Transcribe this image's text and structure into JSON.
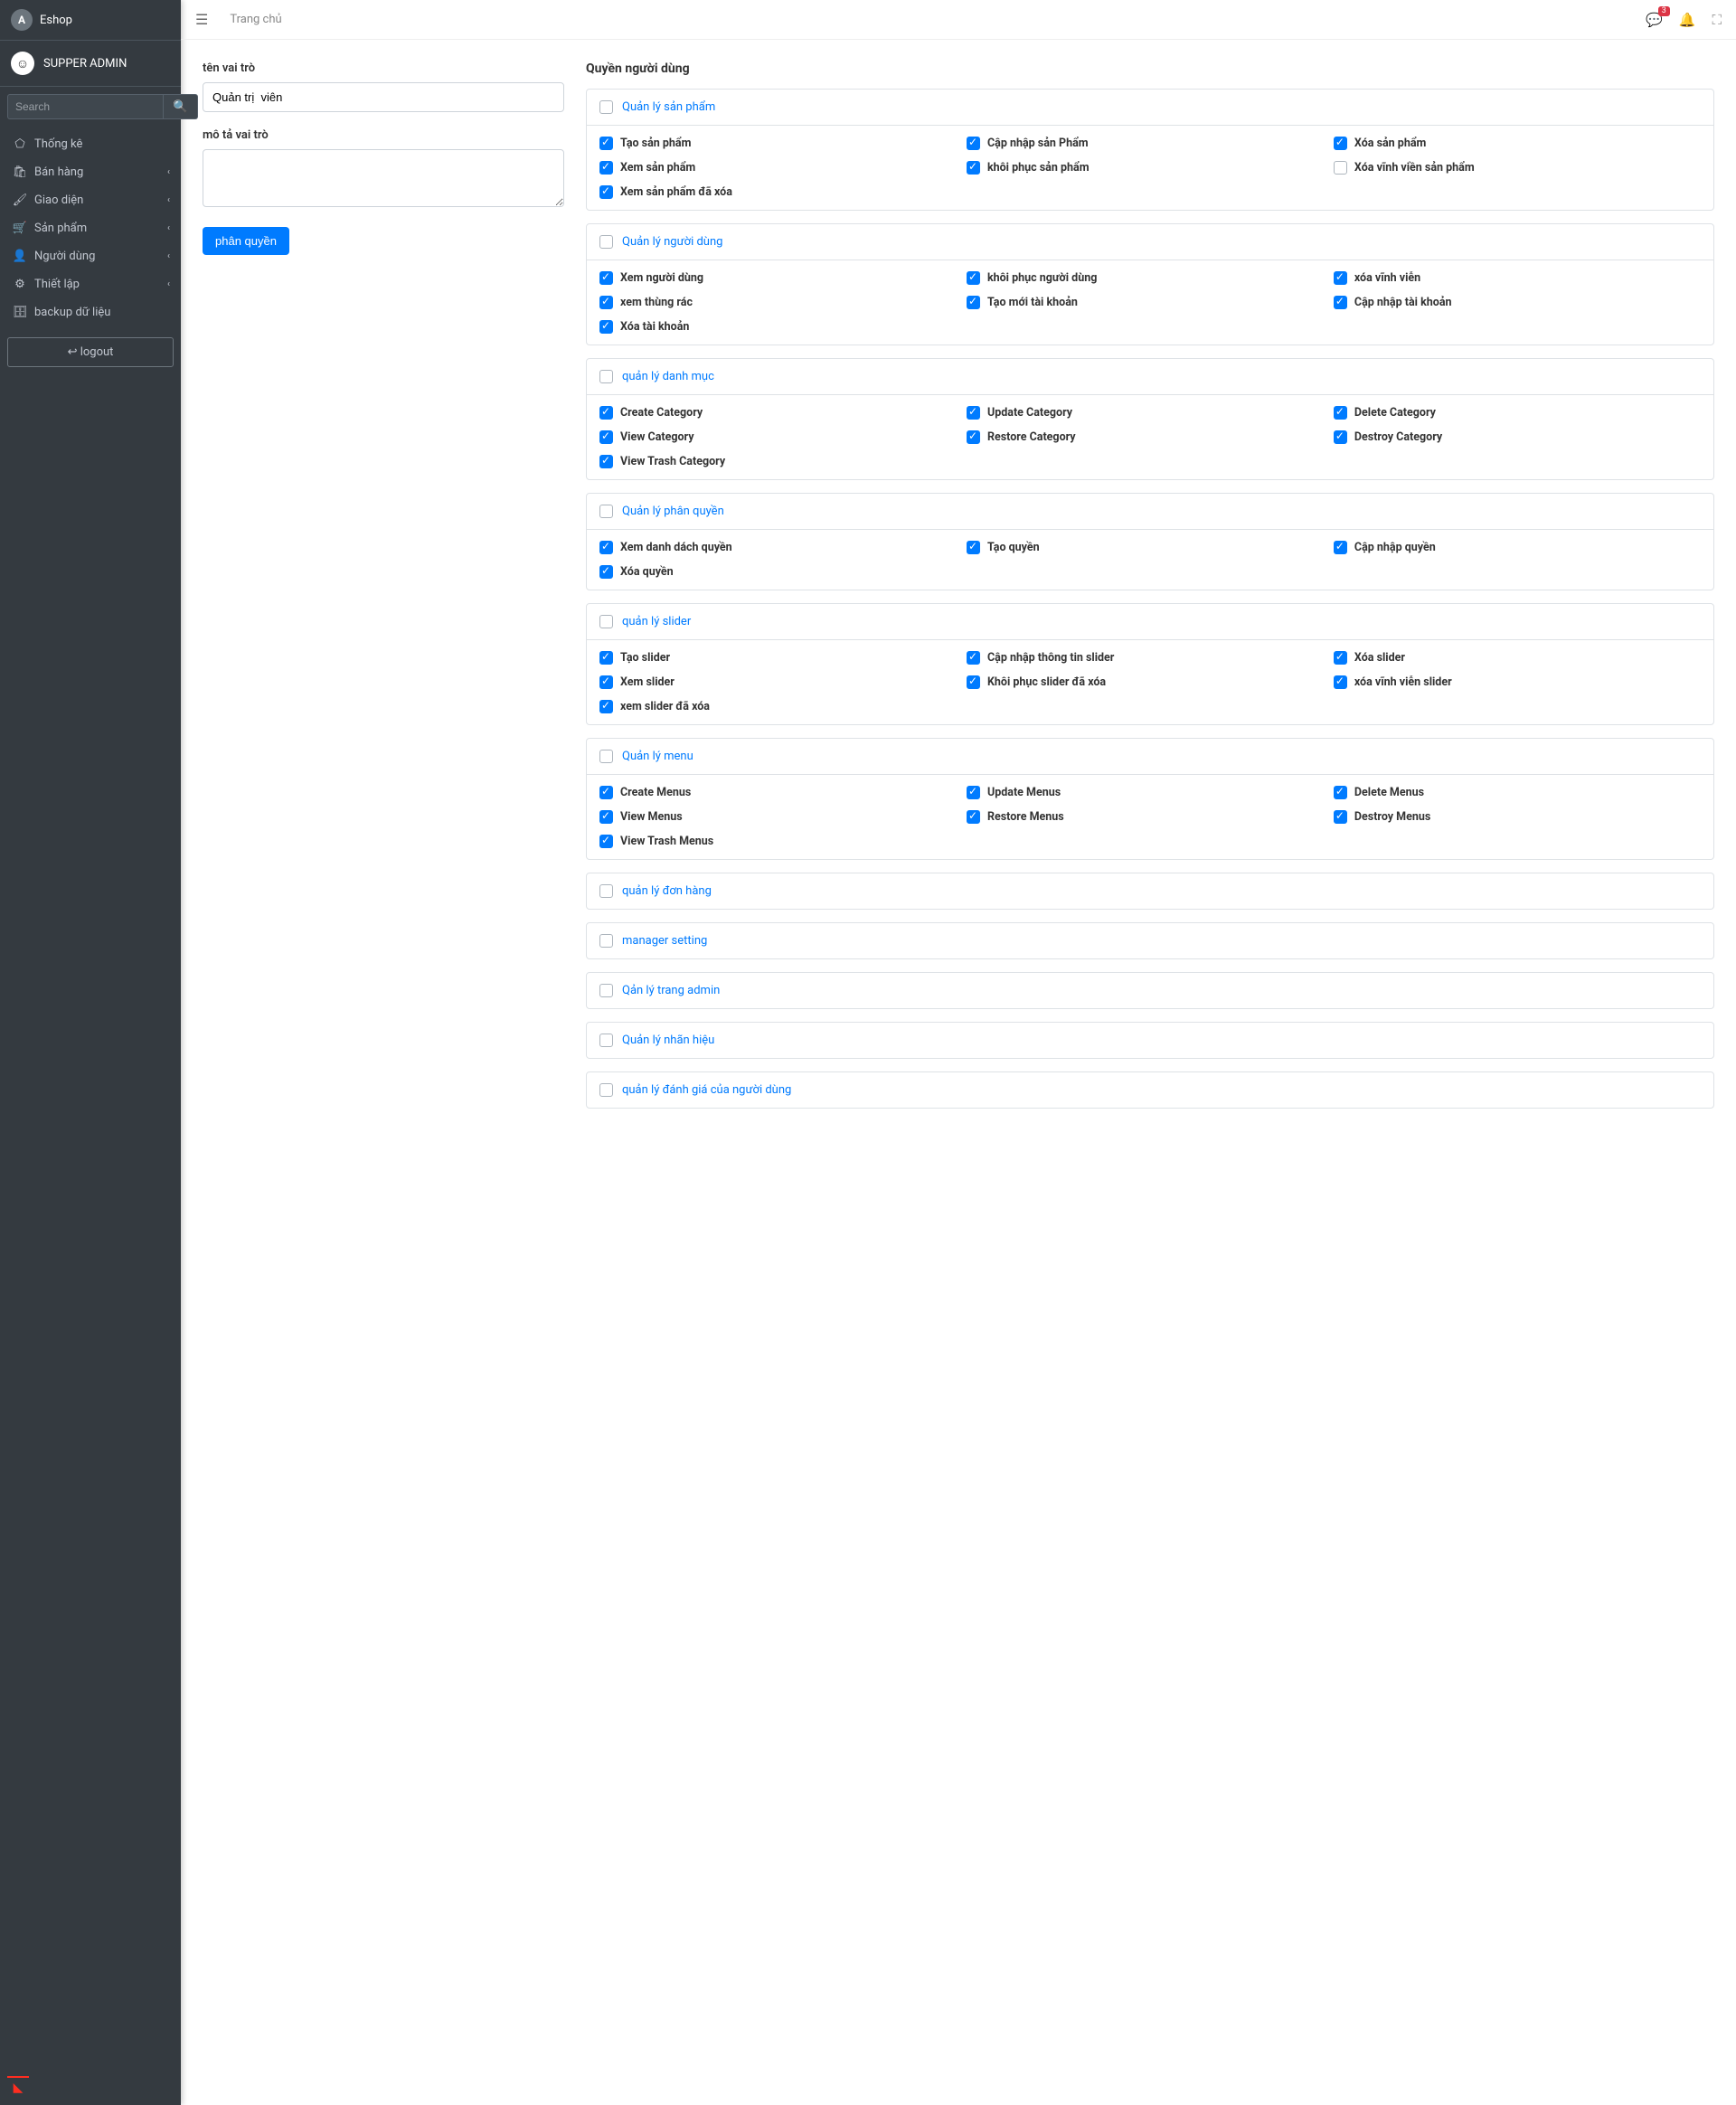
{
  "brand": {
    "name": "Eshop"
  },
  "user": {
    "name": "SUPPER ADMIN"
  },
  "search": {
    "placeholder": "Search"
  },
  "nav": [
    {
      "icon": "⬠",
      "label": "Thống kê",
      "chev": false
    },
    {
      "icon": "🛍",
      "label": "Bán hàng",
      "chev": true
    },
    {
      "icon": "🖌",
      "label": "Giao diện",
      "chev": true
    },
    {
      "icon": "🛒",
      "label": "Sản phẩm",
      "chev": true
    },
    {
      "icon": "👤",
      "label": "Người dùng",
      "chev": true
    },
    {
      "icon": "⚙",
      "label": "Thiết lập",
      "chev": true
    },
    {
      "icon": "🗄",
      "label": "backup dữ liệu",
      "chev": false
    }
  ],
  "logout": {
    "label": "logout"
  },
  "topbar": {
    "breadcrumb": "Trang chủ",
    "msg_badge": "3"
  },
  "form": {
    "role_name_label": "tên vai trò",
    "role_name_value": "Quản trị  viên",
    "role_desc_label": "mô tả vai trò",
    "submit": "phân quyền",
    "perm_title": "Quyền người dùng"
  },
  "groups": [
    {
      "title": "Quản lý sản phẩm",
      "items": [
        {
          "l": "Tạo sản phẩm",
          "c": true
        },
        {
          "l": "Cập nhập sản Phẩm",
          "c": true
        },
        {
          "l": "Xóa sản phẩm",
          "c": true
        },
        {
          "l": "Xem sản phẩm",
          "c": true
        },
        {
          "l": "khôi phục sản phẩm",
          "c": true
        },
        {
          "l": "Xóa vĩnh viền sản phẩm",
          "c": false
        },
        {
          "l": "Xem sản phẩm đã xóa",
          "c": true
        }
      ]
    },
    {
      "title": "Quản lý người dùng",
      "items": [
        {
          "l": "Xem người dùng",
          "c": true
        },
        {
          "l": "khôi phục người dùng",
          "c": true
        },
        {
          "l": "xóa vĩnh viễn",
          "c": true
        },
        {
          "l": "xem thùng rác",
          "c": true
        },
        {
          "l": "Tạo mới tài khoản",
          "c": true
        },
        {
          "l": "Cập nhập tài khoản",
          "c": true
        },
        {
          "l": "Xóa tài khoản",
          "c": true
        }
      ]
    },
    {
      "title": "quản lý danh mục",
      "items": [
        {
          "l": "Create Category",
          "c": true
        },
        {
          "l": "Update Category",
          "c": true
        },
        {
          "l": "Delete Category",
          "c": true
        },
        {
          "l": "View Category",
          "c": true
        },
        {
          "l": "Restore Category",
          "c": true
        },
        {
          "l": "Destroy Category",
          "c": true
        },
        {
          "l": "View Trash Category",
          "c": true
        }
      ]
    },
    {
      "title": "Quản lý phân quyền",
      "items": [
        {
          "l": "Xem danh dách quyền",
          "c": true
        },
        {
          "l": "Tạo quyền",
          "c": true
        },
        {
          "l": "Cập nhập quyền",
          "c": true
        },
        {
          "l": "Xóa quyền",
          "c": true
        }
      ]
    },
    {
      "title": "quản lý slider",
      "items": [
        {
          "l": "Tạo slider",
          "c": true
        },
        {
          "l": "Cập nhập thông tin slider",
          "c": true
        },
        {
          "l": "Xóa slider",
          "c": true
        },
        {
          "l": "Xem slider",
          "c": true
        },
        {
          "l": "Khôi phục slider đã xóa",
          "c": true
        },
        {
          "l": "xóa vĩnh viễn slider",
          "c": true
        },
        {
          "l": "xem slider đã xóa",
          "c": true
        }
      ]
    },
    {
      "title": "Quản lý menu",
      "items": [
        {
          "l": "Create Menus",
          "c": true
        },
        {
          "l": "Update Menus",
          "c": true
        },
        {
          "l": "Delete Menus",
          "c": true
        },
        {
          "l": "View Menus",
          "c": true
        },
        {
          "l": "Restore Menus",
          "c": true
        },
        {
          "l": "Destroy Menus",
          "c": true
        },
        {
          "l": "View Trash Menus",
          "c": true
        }
      ]
    },
    {
      "title": "quản lý đơn hàng",
      "items": []
    },
    {
      "title": "manager setting",
      "items": []
    },
    {
      "title": "Qản lý trang admin",
      "items": []
    },
    {
      "title": "Quản lý nhãn hiệu",
      "items": []
    },
    {
      "title": "quản lý đánh giá của người dùng",
      "items": []
    }
  ]
}
